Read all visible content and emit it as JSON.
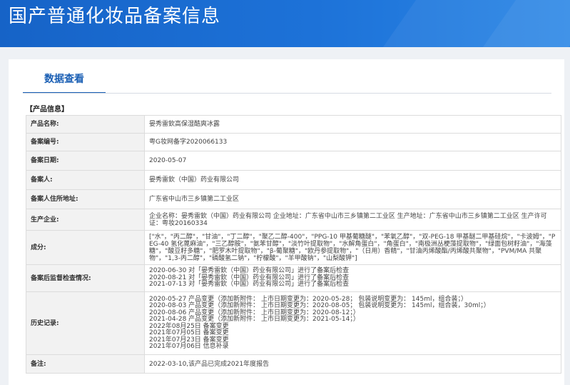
{
  "header": {
    "title": "国产普通化妆品备案信息"
  },
  "tabs": [
    {
      "label": "数据查看"
    }
  ],
  "section": {
    "title": "【产品信息】"
  },
  "rows": [
    {
      "label": "产品名称:",
      "value": "晏秀雷欽高保湿酷爽冰露"
    },
    {
      "label": "备案编号:",
      "value": "粤G妆网备字2020066133"
    },
    {
      "label": "备案日期:",
      "value": "2020-05-07"
    },
    {
      "label": "备案人:",
      "value": "晏秀雷欽（中国）药业有限公司"
    },
    {
      "label": "备案人住所地址:",
      "value": "广东省中山市三乡镇第二工业区"
    },
    {
      "label": "生产企业:",
      "value": "企业名称：晏秀雷欽（中国）药业有限公司 企业地址：广东省中山市三乡镇第二工业区 生产地址：广东省中山市三乡镇第二工业区 生产许可证：粤妆20160334"
    },
    {
      "label": "成分:",
      "value": "[\"水\"，\"丙二醇\"，\"甘油\"，\"丁二醇\"，\"聚乙二醇-400\"，\"PPG-10 甲基葡糖醚\"，\"苯氧乙醇\"，\"双-PEG-18 甲基醚二甲基硅烷\"，\"卡波姆\"，\"PEG-40 氢化蓖麻油\"，\"三乙醇胺\"，\"氨苯甘醇\"，\"淡竹叶提取物\"，\"水解角蛋白\"，\"角蛋白\"，\"南极洲丛梗藻提取物\"，\"绿面包树籽油\"，\"海藻糖\"，\"酸豆籽多糖\"，\"肥罗木叶提取物\"，\"β-葡聚糖\"，\"欧丹参提取物\"，\"（日用）香精\"，\"甘油丙烯酸酯/丙烯酸共聚物\"，\"PVM/MA 共聚物\"，\"1,3-丙二醇\"，\"磷酸氢二钠\"，\"柠檬酸\"，\"羊甲酸钠\"，\"山梨酸钾\"]"
    },
    {
      "label": "备案后监督检查情况:",
      "lines": [
        "2020-06-30 对「晏秀雷欽（中国）药业有限公司」进行了备案后检查",
        "2020-08-21 对「晏秀雷欽（中国）药业有限公司」进行了备案后检查",
        "2021-07-13 对「晏秀雷欽（中国）药业有限公司」进行了备案后检查"
      ]
    },
    {
      "label": "历史记录:",
      "lines": [
        "2020-05-27 产品变更（添加新附件： 上市日期变更为：2020-05-28； 包装说明变更为： 145ml，组合装；）",
        "2020-08-03 产品变更（添加新附件： 上市日期变更为：2020-08-05； 包装说明变更为： 145ml，组合装，30ml；）",
        "2020-08-06 产品变更（添加新附件： 上市日期变更为：2020-08-12；）",
        "2021-04-28 产品变更（添加新附件： 上市日期变更为：2021-05-14；）",
        "2022年08月25日 备案变更",
        "2021年07月05日 备案变更",
        "2021年07月23日 备案变更",
        "2021年07月06日 信息补录"
      ]
    },
    {
      "label": "备注:",
      "value": "2022-03-10,该产品已完成2021年度报告"
    }
  ],
  "colors": {
    "header": "#1d72d8",
    "accent": "#1a5fb4",
    "label_bg": "#f2f2f2"
  }
}
